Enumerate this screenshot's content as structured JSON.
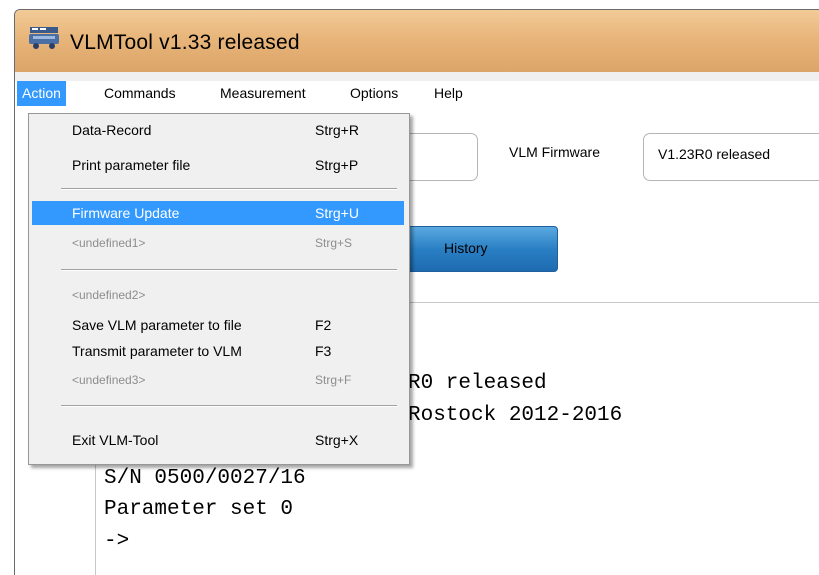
{
  "window": {
    "title": "VLMTool  v1.33 released",
    "icon": "app-icon"
  },
  "menubar": {
    "items": [
      {
        "label": "Action",
        "active": true
      },
      {
        "label": "Commands"
      },
      {
        "label": "Measurement"
      },
      {
        "label": "Options"
      },
      {
        "label": "Help"
      }
    ]
  },
  "action_menu": {
    "items": [
      {
        "label": "Data-Record",
        "shortcut": "Strg+R"
      },
      {
        "label": "Print parameter file",
        "shortcut": "Strg+P"
      },
      {
        "label": "Firmware Update",
        "shortcut": "Strg+U",
        "highlighted": true
      },
      {
        "label": "<undefined1>",
        "shortcut": "Strg+S",
        "disabled": true
      },
      {
        "label": "<undefined2>",
        "shortcut": "",
        "disabled": true
      },
      {
        "label": "Save VLM parameter to file",
        "shortcut": "F2"
      },
      {
        "label": "Transmit parameter to VLM",
        "shortcut": "F3"
      },
      {
        "label": "<undefined3>",
        "shortcut": "Strg+F",
        "disabled": true
      },
      {
        "label": "Exit VLM-Tool",
        "shortcut": "Strg+X"
      }
    ]
  },
  "firmware": {
    "label": "VLM Firmware",
    "value": "V1.23R0 released"
  },
  "history_button": {
    "label": "History"
  },
  "terminal": {
    "lines": [
      "R0 released",
      "Rostock 2012-2016",
      "S/N 0500/0027/16",
      "Parameter set 0",
      "->"
    ]
  },
  "colors": {
    "highlight": "#3399ff",
    "titlebar": "#e8b57a",
    "button": "#2a7fc4"
  }
}
